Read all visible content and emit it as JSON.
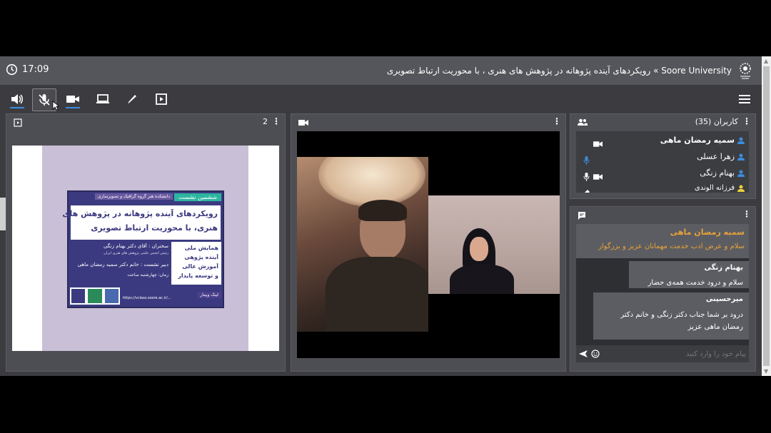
{
  "header": {
    "time": "17:09",
    "title": "Soore University » رویکردهای آینده پژوهانه در پژوهش های هنری ، با محوریت ارتباط تصویری"
  },
  "toolbar": {
    "items": [
      "speaker-icon",
      "mic-muted-icon",
      "camera-icon",
      "screen-share-icon",
      "pen-icon",
      "play-icon",
      "menu-icon"
    ]
  },
  "presentation": {
    "page": "2",
    "poster": {
      "tag": "ششمین نشست",
      "dept": "دانشکده هنر گروه گرافیک و تصویرسازی",
      "title1": "رویکردهای آینده پژوهانه در پژوهش های",
      "title2": "هنری، با محوریت ارتباط تصویری",
      "speaker": "سخنران : آقای دکتر بهنام زنگی",
      "speaker_sub": "رئیس انجمن علمی پژوهش های هنری ایران",
      "secretary": "دبیر نشست : خانم دکتر سمیه رمضان ماهی",
      "time": "زمان: چهارشنبه ساعت",
      "side1": "همایش ملی",
      "side2": "آینده پژوهی",
      "side3": "آموزش عالی",
      "side4": "و توسعه پایدار",
      "link_label": "لینک وبینار",
      "link": "https://vclass.soore.ac.ir/..."
    }
  },
  "participants": {
    "title": "کاربران (35)",
    "users": [
      {
        "name": "سمیه رمضان ماهی",
        "bold": true
      },
      {
        "name": "زهرا عسلی",
        "bold": false
      },
      {
        "name": "بهنام زنگی",
        "bold": false
      },
      {
        "name": "فرزانه الوندی",
        "bold": false
      }
    ]
  },
  "chat": {
    "messages": [
      {
        "author": "سمیه رمضان ماهی",
        "text": "سلام و عرض ادب خدمت مهمانان عزیز و بزرگوار"
      },
      {
        "author": "بهنام زنگی",
        "text": "سلام و درود خدمت همه‌ی حضار"
      },
      {
        "author": "میرحسینی",
        "text": "درود بر شما جناب دکتر زنگی و خانم دکتر رمضان ماهی عزیز"
      }
    ],
    "placeholder": "پیام خود را وارد کنید"
  },
  "colors": {
    "accent": "#3b8ce0",
    "highlight": "#e8a23a"
  }
}
